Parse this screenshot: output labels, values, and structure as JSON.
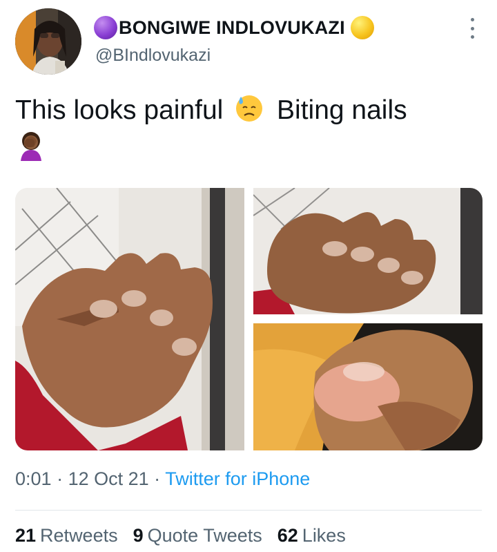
{
  "author": {
    "name": "BONGIWE INDLOVUKAZI",
    "handle": "@BIndlovukazi",
    "badge_left_color": "#8a3fd4",
    "badge_right_color": "#f7c520"
  },
  "tweet": {
    "text_part1": "This looks painful",
    "text_part2": "Biting nails",
    "emojis": [
      "downcast-face-with-sweat",
      "woman-facepalming"
    ]
  },
  "media": {
    "count": 3,
    "items": [
      "nail-photo-large",
      "nail-photo-top-right",
      "nail-photo-bottom-right"
    ]
  },
  "meta": {
    "time": "0:01",
    "date": "12 Oct 21",
    "separator": "·",
    "source": "Twitter for iPhone"
  },
  "stats": {
    "retweets_count": "21",
    "retweets_label": "Retweets",
    "quotes_count": "9",
    "quotes_label": "Quote Tweets",
    "likes_count": "62",
    "likes_label": "Likes"
  },
  "colors": {
    "text": "#0f1419",
    "muted": "#536471",
    "link": "#1d9bf0",
    "divider": "#e1e6ea"
  }
}
